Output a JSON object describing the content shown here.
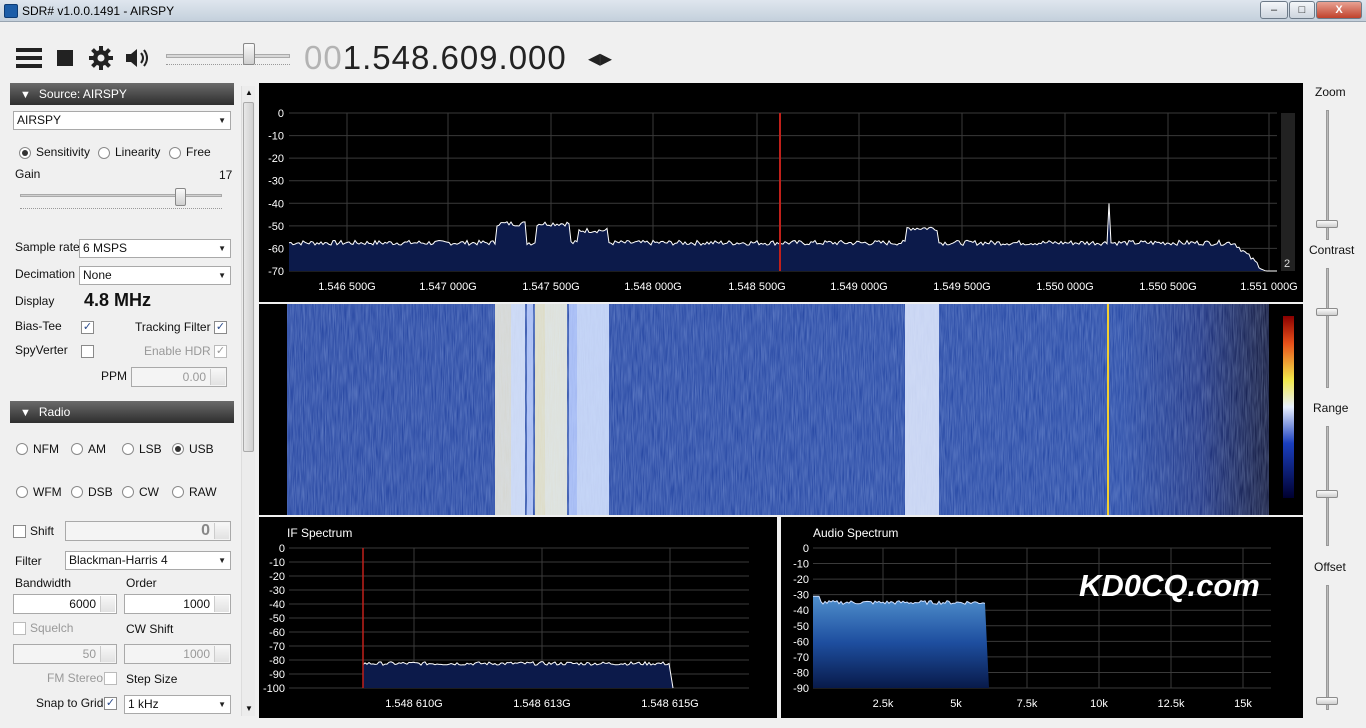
{
  "window": {
    "title": "SDR# v1.0.0.1491 - AIRSPY",
    "min": "–",
    "max": "□",
    "close": "X"
  },
  "toolbar": {
    "freq_dim": "00",
    "freq_main": "1.548.609.000",
    "tuner_arrows": "◂▸",
    "volume_fraction": 0.7
  },
  "source": {
    "header": "Source: AIRSPY",
    "device": "AIRSPY",
    "modes": [
      "Sensitivity",
      "Linearity",
      "Free"
    ],
    "mode_selected": "Sensitivity",
    "gain_label": "Gain",
    "gain_value": "17",
    "sample_rate_label": "Sample rate",
    "sample_rate": "6 MSPS",
    "decimation_label": "Decimation",
    "decimation": "None",
    "display_label": "Display",
    "display_value": "4.8 MHz",
    "bias_tee": "Bias-Tee",
    "tracking_filter": "Tracking Filter",
    "spyverter": "SpyVerter",
    "enable_hdr": "Enable HDR",
    "ppm_label": "PPM",
    "ppm_value": "0.00"
  },
  "radio": {
    "header": "Radio",
    "modes_row1": [
      "NFM",
      "AM",
      "LSB",
      "USB"
    ],
    "modes_row2": [
      "WFM",
      "DSB",
      "CW",
      "RAW"
    ],
    "mode_selected": "USB",
    "shift_label": "Shift",
    "shift_value": "0",
    "filter_label": "Filter",
    "filter_value": "Blackman-Harris 4",
    "bandwidth_label": "Bandwidth",
    "bandwidth_value": "6000",
    "order_label": "Order",
    "order_value": "1000",
    "squelch_label": "Squelch",
    "squelch_value": "50",
    "cwshift_label": "CW Shift",
    "cwshift_value": "1000",
    "fmstereo_label": "FM Stereo",
    "stepsize_label": "Step Size",
    "snap_label": "Snap to Grid",
    "step_value": "1 kHz"
  },
  "spectrum": {
    "y_ticks": [
      "0",
      "-10",
      "-20",
      "-30",
      "-40",
      "-50",
      "-60",
      "-70"
    ],
    "x_ticks": [
      "1.546 500G",
      "1.547 000G",
      "1.547 500G",
      "1.548 000G",
      "1.548 500G",
      "1.549 000G",
      "1.549 500G",
      "1.550 000G",
      "1.550 500G",
      "1.551 000G"
    ],
    "badge": "2"
  },
  "if_spectrum": {
    "title": "IF Spectrum",
    "y_ticks": [
      "0",
      "-10",
      "-20",
      "-30",
      "-40",
      "-50",
      "-60",
      "-70",
      "-80",
      "-90",
      "-100"
    ],
    "x_ticks": [
      "1.548 610G",
      "1.548 613G",
      "1.548 615G"
    ]
  },
  "audio_spectrum": {
    "title": "Audio Spectrum",
    "y_ticks": [
      "0",
      "-10",
      "-20",
      "-30",
      "-40",
      "-50",
      "-60",
      "-70",
      "-80",
      "-90"
    ],
    "x_ticks": [
      "2.5k",
      "5k",
      "7.5k",
      "10k",
      "12.5k",
      "15k"
    ]
  },
  "watermark": "KD0CQ.com",
  "right_panel": {
    "zoom": "Zoom",
    "contrast": "Contrast",
    "range": "Range",
    "offset": "Offset"
  },
  "colors": {
    "spectrum_fill": "#0c1a4a",
    "waterfall_base": "#1a3d9a",
    "marker": "#c0201a"
  }
}
